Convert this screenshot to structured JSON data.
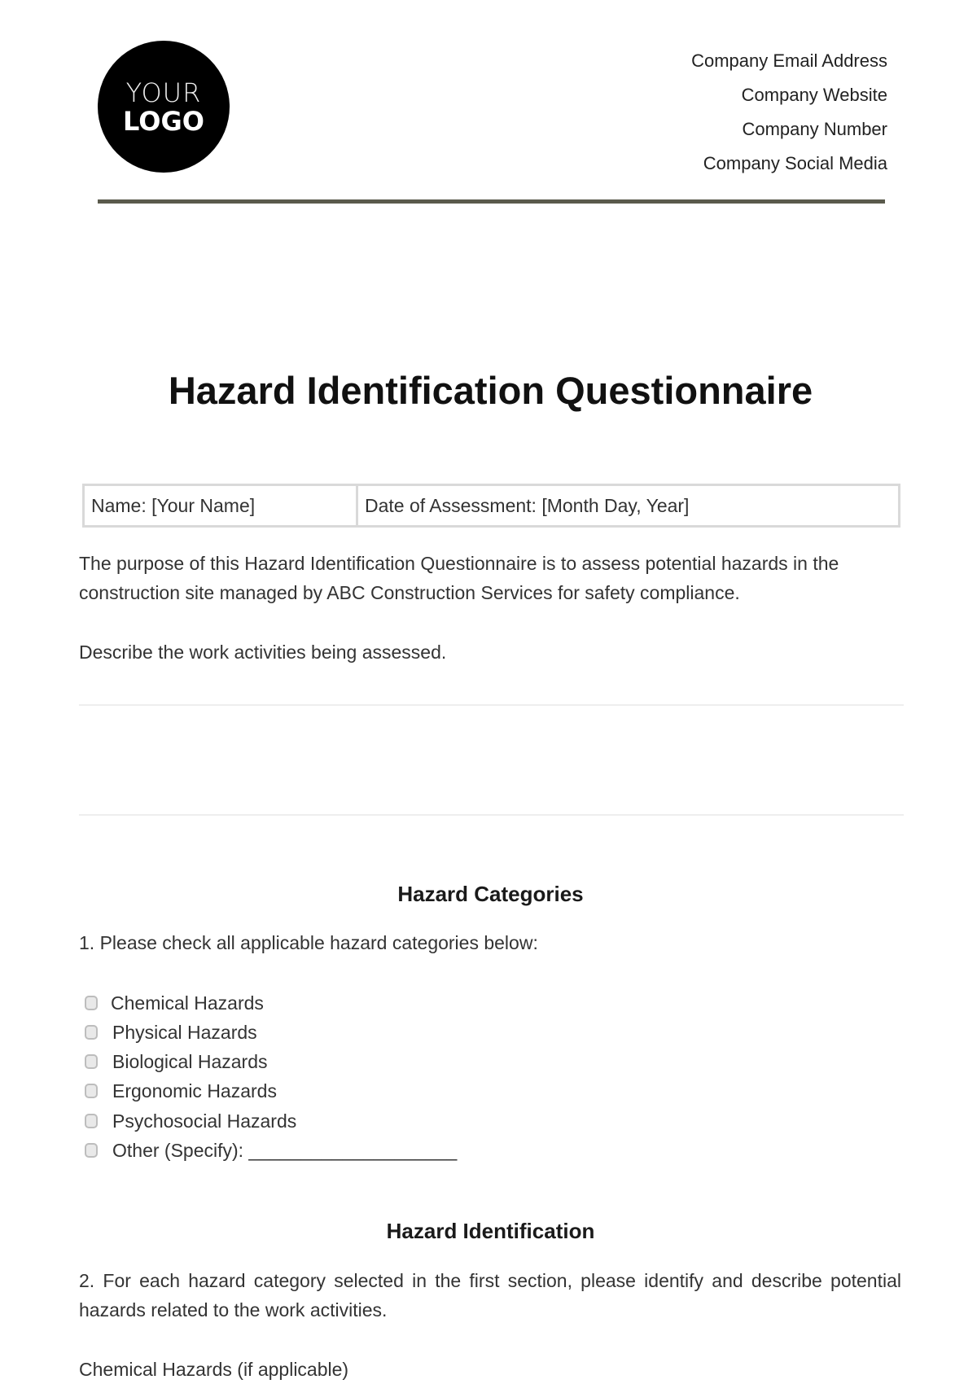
{
  "header": {
    "logo": {
      "line1": "YOUR",
      "line2": "LOGO"
    },
    "contact": [
      "Company Email Address",
      "Company Website",
      "Company Number",
      "Company Social Media"
    ],
    "rule_color": "#5a5a4c"
  },
  "title": "Hazard Identification Questionnaire",
  "info_table": {
    "name": "Name: [Your Name]",
    "date": "Date of Assessment: [Month Day, Year]"
  },
  "intro": "The purpose of this Hazard Identification Questionnaire is to assess potential hazards in the construction site managed by ABC Construction Services for safety compliance.",
  "work_activities_prompt": "Describe the work activities being assessed.",
  "hazard_categories": {
    "heading": "Hazard Categories",
    "question": "1. Please check all applicable hazard categories below:",
    "options": [
      {
        "label": "Chemical Hazards",
        "checked": false
      },
      {
        "label": "Physical Hazards",
        "checked": false
      },
      {
        "label": "Biological Hazards",
        "checked": false
      },
      {
        "label": "Ergonomic Hazards",
        "checked": false
      },
      {
        "label": "Psychosocial Hazards",
        "checked": false
      },
      {
        "label": "Other (Specify): ____________________",
        "checked": false
      }
    ]
  },
  "hazard_identification": {
    "heading": "Hazard Identification",
    "question": "2. For each hazard category selected in the first section, please identify and describe potential hazards related to the work activities.",
    "subheading": "Chemical Hazards (if applicable)"
  }
}
